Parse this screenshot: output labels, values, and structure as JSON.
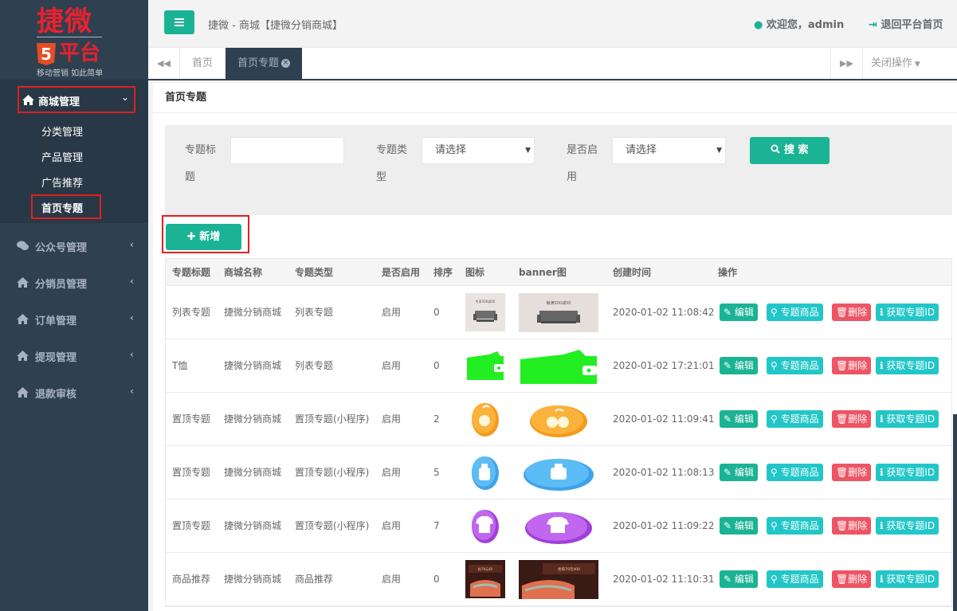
{
  "sidebar": {
    "logo_main": "捷微",
    "logo_five": "5",
    "logo_ping": "平台",
    "logo_slogan": "移动营销 如此简单",
    "main_item": "商城管理",
    "sub_items": [
      "分类管理",
      "产品管理",
      "广告推荐",
      "首页专题"
    ],
    "nav_items": [
      "公众号管理",
      "分销员管理",
      "订单管理",
      "提现管理",
      "退款审核"
    ]
  },
  "topbar": {
    "title": "捷微 - 商城【捷微分销商城】",
    "welcome": "欢迎您，admin",
    "logout": "退回平台首页"
  },
  "tabs": {
    "home": "首页",
    "active": "首页专题",
    "close_ops": "关闭操作"
  },
  "page": {
    "heading": "首页专题",
    "filters": {
      "title_label": "专题标题",
      "title_value": "",
      "type_label": "专题类型",
      "type_value": "请选择",
      "enabled_label": "是否启用",
      "enabled_value": "请选择",
      "search_btn": "搜 索"
    },
    "add_btn": "新增"
  },
  "table": {
    "headers": [
      "专题标题",
      "商城名称",
      "专题类型",
      "是否启用",
      "排序",
      "图标",
      "banner图",
      "创建时间",
      "操作"
    ],
    "rows": [
      {
        "title": "列表专题",
        "mall": "捷微分销商城",
        "type": "列表专题",
        "enabled": "启用",
        "sort": "0",
        "time": "2020-01-02 11:08:42",
        "img": "sofa-photo"
      },
      {
        "title": "T恤",
        "mall": "捷微分销商城",
        "type": "列表专题",
        "enabled": "启用",
        "sort": "0",
        "time": "2020-01-02 17:21:01",
        "img": "wallet"
      },
      {
        "title": "置顶专题",
        "mall": "捷微分销商城",
        "type": "置顶专题(小程序)",
        "enabled": "启用",
        "sort": "2",
        "time": "2020-01-02 11:09:41",
        "img": "orange"
      },
      {
        "title": "置顶专题",
        "mall": "捷微分销商城",
        "type": "置顶专题(小程序)",
        "enabled": "启用",
        "sort": "5",
        "time": "2020-01-02 11:08:13",
        "img": "bottle"
      },
      {
        "title": "置顶专题",
        "mall": "捷微分销商城",
        "type": "置顶专题(小程序)",
        "enabled": "启用",
        "sort": "7",
        "time": "2020-01-02 11:09:22",
        "img": "tshirt"
      },
      {
        "title": "商品推荐",
        "mall": "捷微分销商城",
        "type": "商品推荐",
        "enabled": "启用",
        "sort": "0",
        "time": "2020-01-02 11:10:31",
        "img": "bedding-photo"
      }
    ],
    "actions": {
      "edit": "编辑",
      "goods": "专题商品",
      "delete": "删除",
      "get_id": "获取专题ID"
    },
    "sofa_icon_caption": "专享500减50",
    "sofa_banner_caption": "每满500减50",
    "bed_icon_caption": "抢79元40",
    "bed_banner_caption": "抢购79元400"
  },
  "colors": {
    "accent": "#1ab394",
    "sidebar": "#2f4050",
    "danger": "#ed5565",
    "info": "#23c6c8",
    "highlight": "#e02020"
  }
}
